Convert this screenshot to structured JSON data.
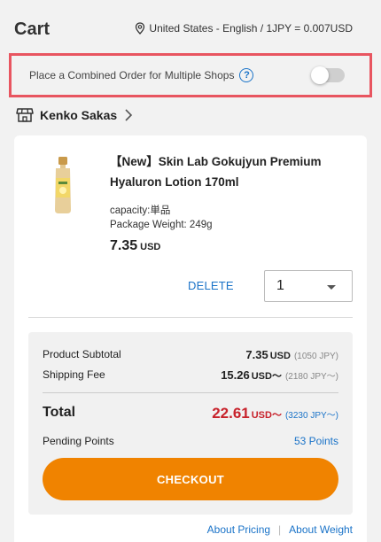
{
  "header": {
    "title": "Cart",
    "locale": "United States - English / 1JPY = 0.007USD"
  },
  "combined_order": {
    "label": "Place a Combined Order for Multiple Shops",
    "help": "?",
    "enabled": false
  },
  "shop": {
    "name": "Kenko Sakas"
  },
  "item": {
    "name": "【New】Skin Lab Gokujyun Premium Hyaluron Lotion 170ml",
    "capacity": "capacity:単品",
    "weight": "Package Weight: 249g",
    "price": "7.35",
    "price_unit": "USD",
    "delete_label": "DELETE",
    "quantity": "1"
  },
  "summary": {
    "subtotal_label": "Product Subtotal",
    "subtotal_usd": "7.35",
    "subtotal_unit": "USD",
    "subtotal_jpy": "(1050 JPY)",
    "shipping_label": "Shipping Fee",
    "shipping_usd": "15.26",
    "shipping_unit": "USD～",
    "shipping_jpy": "(2180 JPY～)",
    "total_label": "Total",
    "total_usd": "22.61",
    "total_unit": "USD～",
    "total_jpy": "(3230 JPY～)",
    "points_label": "Pending Points",
    "points_value": "53 Points",
    "checkout_label": "CHECKOUT"
  },
  "footer_links": {
    "pricing": "About Pricing",
    "separator": "|",
    "weight": "About Weight"
  },
  "colors": {
    "accent": "#1a73c8",
    "checkout": "#f08300",
    "total": "#c8232c",
    "highlight_border": "#e85560"
  }
}
